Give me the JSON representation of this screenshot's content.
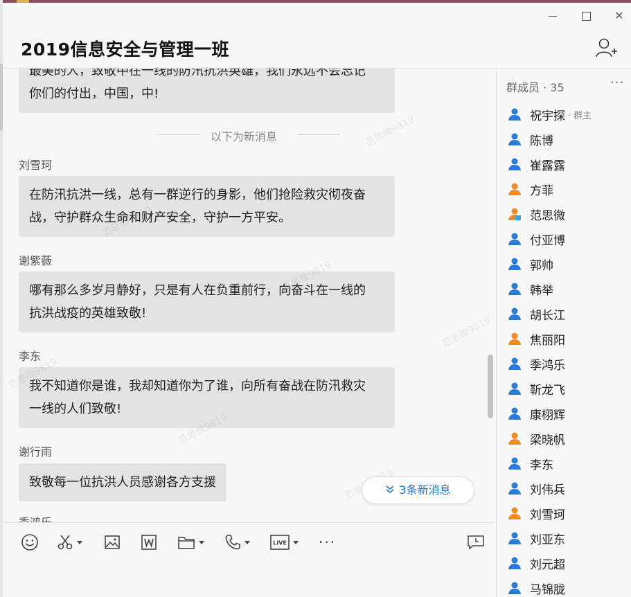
{
  "window": {
    "title": "2019信息安全与管理一班",
    "controls": {
      "minimize": "—",
      "maximize": "☐",
      "close": "✕"
    }
  },
  "chat": {
    "partial_top_line": "最美的人，致敬中在一线的防汛抗洪英雄，我们永远不会忘记",
    "first_bubble_tail": "你们的付出，中国，中!",
    "new_divider": "以下为新消息",
    "messages": [
      {
        "sender": "刘雪珂",
        "lines": [
          "在防汛抗洪一线，总有一群逆行的身影，他们抢险救灾彻夜奋",
          "战，守护群众生命和财产安全，守护一方平安。"
        ]
      },
      {
        "sender": "谢紫薇",
        "lines": [
          "哪有那么多岁月静好，只是有人在负重前行，向奋斗在一线的",
          "抗洪战疫的英雄致敬!"
        ]
      },
      {
        "sender": "李东",
        "lines": [
          "我不知道你是谁，我却知道你为了谁，向所有奋战在防汛救灾",
          "一线的人们致敬!"
        ]
      },
      {
        "sender": "谢行雨",
        "lines": [
          "致敬每一位抗洪人员感谢各方支援"
        ]
      }
    ],
    "partial_next_sender": "季鸿乐",
    "watermark": "范思微9819",
    "new_messages_button": "3条新消息"
  },
  "toolbar": {
    "icons": [
      "emoji-icon",
      "scissors-icon",
      "image-icon",
      "word-doc-icon",
      "folder-icon",
      "phone-icon",
      "live-icon",
      "more-icon"
    ],
    "live_label": "LIVE",
    "more_label": "···"
  },
  "members": {
    "header": "群成员 · 35",
    "more": "···",
    "list": [
      {
        "name": "祝宇探",
        "role": "· 群主",
        "color": "#2b7bd6"
      },
      {
        "name": "陈博",
        "role": "",
        "color": "#2b7bd6"
      },
      {
        "name": "崔露露",
        "role": "",
        "color": "#2b7bd6"
      },
      {
        "name": "方菲",
        "role": "",
        "color": "#f08a24"
      },
      {
        "name": "范思微",
        "role": "",
        "color": "#f08a24",
        "device": true
      },
      {
        "name": "付亚博",
        "role": "",
        "color": "#2b7bd6"
      },
      {
        "name": "郭帅",
        "role": "",
        "color": "#2b7bd6"
      },
      {
        "name": "韩举",
        "role": "",
        "color": "#2b7bd6"
      },
      {
        "name": "胡长江",
        "role": "",
        "color": "#2b7bd6"
      },
      {
        "name": "焦丽阳",
        "role": "",
        "color": "#f08a24"
      },
      {
        "name": "季鸿乐",
        "role": "",
        "color": "#2b7bd6"
      },
      {
        "name": "靳龙飞",
        "role": "",
        "color": "#2b7bd6"
      },
      {
        "name": "康栩辉",
        "role": "",
        "color": "#2b7bd6"
      },
      {
        "name": "梁晓帆",
        "role": "",
        "color": "#f08a24"
      },
      {
        "name": "李东",
        "role": "",
        "color": "#2b7bd6"
      },
      {
        "name": "刘伟兵",
        "role": "",
        "color": "#2b7bd6"
      },
      {
        "name": "刘雪珂",
        "role": "",
        "color": "#f08a24"
      },
      {
        "name": "刘亚东",
        "role": "",
        "color": "#2b7bd6"
      },
      {
        "name": "刘元超",
        "role": "",
        "color": "#2b7bd6"
      },
      {
        "name": "马锦胧",
        "role": "",
        "color": "#2b7bd6"
      }
    ]
  }
}
